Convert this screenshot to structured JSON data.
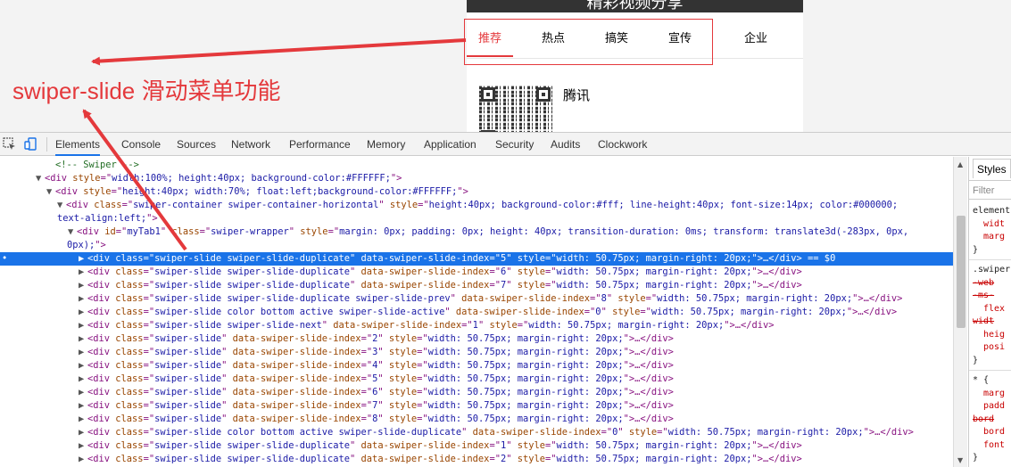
{
  "preview": {
    "header_title": "精彩视频分享",
    "tabs": [
      "推荐",
      "热点",
      "搞笑",
      "宣传",
      "企业"
    ],
    "active_tab_index": 0,
    "news_title": "腾讯"
  },
  "annotation": {
    "text": "swiper-slide 滑动菜单功能",
    "color": "#e4393c"
  },
  "devtools": {
    "tabs": [
      "Elements",
      "Console",
      "Sources",
      "Network",
      "Performance",
      "Memory",
      "Application",
      "Security",
      "Audits",
      "Clockwork"
    ],
    "active_tab": "Elements",
    "lines": [
      {
        "indent": 3,
        "tri": "",
        "html": "<span class='cm'>&lt;!-- Swiper --&gt;</span>"
      },
      {
        "indent": 2,
        "tri": "▼",
        "html": "&lt;div <span class='an'>style</span>=\"<span class='av'>width:100%; height:40px; background-color:#FFFFFF;</span>\"&gt;"
      },
      {
        "indent": 3,
        "tri": "▼",
        "html": "&lt;div <span class='an'>style</span>=\"<span class='av'>height:40px; width:70%; float:left;background-color:#FFFFFF;</span>\"&gt;"
      },
      {
        "indent": 4,
        "tri": "▼",
        "html": "&lt;div <span class='an'>class</span>=\"<span class='av'>swiper-container swiper-container-horizontal</span>\" <span class='an'>style</span>=\"<span class='av'>height:40px; background-color:#fff; line-height:40px; font-size:14px; color:#000000;</span>"
      },
      {
        "indent": 0,
        "tri": "",
        "pad": 54,
        "html": "<span class='av'>text-align:left;</span>\"&gt;"
      },
      {
        "indent": 5,
        "tri": "▼",
        "html": "&lt;div <span class='an'>id</span>=\"<span class='av'>myTab1</span>\" <span class='an'>class</span>=\"<span class='av'>swiper-wrapper</span>\" <span class='an'>style</span>=\"<span class='av'>margin: 0px; padding: 0px; height: 40px; transition-duration: 0ms; transform: translate3d(-283px, 0px,</span>"
      },
      {
        "indent": 0,
        "tri": "",
        "pad": 65,
        "html": "<span class='av'>0px);</span>\"&gt;"
      },
      {
        "indent": 6,
        "tri": "▶",
        "sel": true,
        "html": "&lt;div <span class='an'>class</span>=\"<span class='av'>swiper-slide  swiper-slide-duplicate</span>\" <span class='an'>data-swiper-slide-index</span>=\"<span class='av'>5</span>\" <span class='an'>style</span>=\"<span class='av'>width: 50.75px; margin-right: 20px;</span>\"&gt;…&lt;/div&gt; == $0"
      },
      {
        "indent": 6,
        "tri": "▶",
        "html": "&lt;div <span class='an'>class</span>=\"<span class='av'>swiper-slide  swiper-slide-duplicate</span>\" <span class='an'>data-swiper-slide-index</span>=\"<span class='av'>6</span>\" <span class='an'>style</span>=\"<span class='av'>width: 50.75px; margin-right: 20px;</span>\"&gt;…&lt;/div&gt;"
      },
      {
        "indent": 6,
        "tri": "▶",
        "html": "&lt;div <span class='an'>class</span>=\"<span class='av'>swiper-slide  swiper-slide-duplicate</span>\" <span class='an'>data-swiper-slide-index</span>=\"<span class='av'>7</span>\" <span class='an'>style</span>=\"<span class='av'>width: 50.75px; margin-right: 20px;</span>\"&gt;…&lt;/div&gt;"
      },
      {
        "indent": 6,
        "tri": "▶",
        "html": "&lt;div <span class='an'>class</span>=\"<span class='av'>swiper-slide  swiper-slide-duplicate swiper-slide-prev</span>\" <span class='an'>data-swiper-slide-index</span>=\"<span class='av'>8</span>\" <span class='an'>style</span>=\"<span class='av'>width: 50.75px; margin-right: 20px;</span>\"&gt;…&lt;/div&gt;"
      },
      {
        "indent": 6,
        "tri": "▶",
        "html": "&lt;div <span class='an'>class</span>=\"<span class='av'>swiper-slide color bottom active swiper-slide-active</span>\" <span class='an'>data-swiper-slide-index</span>=\"<span class='av'>0</span>\" <span class='an'>style</span>=\"<span class='av'>width: 50.75px; margin-right: 20px;</span>\"&gt;…&lt;/div&gt;"
      },
      {
        "indent": 6,
        "tri": "▶",
        "html": "&lt;div <span class='an'>class</span>=\"<span class='av'>swiper-slide swiper-slide-next</span>\" <span class='an'>data-swiper-slide-index</span>=\"<span class='av'>1</span>\" <span class='an'>style</span>=\"<span class='av'>width: 50.75px; margin-right: 20px;</span>\"&gt;…&lt;/div&gt;"
      },
      {
        "indent": 6,
        "tri": "▶",
        "html": "&lt;div <span class='an'>class</span>=\"<span class='av'>swiper-slide</span>\" <span class='an'>data-swiper-slide-index</span>=\"<span class='av'>2</span>\" <span class='an'>style</span>=\"<span class='av'>width: 50.75px; margin-right: 20px;</span>\"&gt;…&lt;/div&gt;"
      },
      {
        "indent": 6,
        "tri": "▶",
        "html": "&lt;div <span class='an'>class</span>=\"<span class='av'>swiper-slide</span>\" <span class='an'>data-swiper-slide-index</span>=\"<span class='av'>3</span>\" <span class='an'>style</span>=\"<span class='av'>width: 50.75px; margin-right: 20px;</span>\"&gt;…&lt;/div&gt;"
      },
      {
        "indent": 6,
        "tri": "▶",
        "html": "&lt;div <span class='an'>class</span>=\"<span class='av'>swiper-slide</span>\" <span class='an'>data-swiper-slide-index</span>=\"<span class='av'>4</span>\" <span class='an'>style</span>=\"<span class='av'>width: 50.75px; margin-right: 20px;</span>\"&gt;…&lt;/div&gt;"
      },
      {
        "indent": 6,
        "tri": "▶",
        "html": "&lt;div <span class='an'>class</span>=\"<span class='av'>swiper-slide</span>\" <span class='an'>data-swiper-slide-index</span>=\"<span class='av'>5</span>\" <span class='an'>style</span>=\"<span class='av'>width: 50.75px; margin-right: 20px;</span>\"&gt;…&lt;/div&gt;"
      },
      {
        "indent": 6,
        "tri": "▶",
        "html": "&lt;div <span class='an'>class</span>=\"<span class='av'>swiper-slide</span>\" <span class='an'>data-swiper-slide-index</span>=\"<span class='av'>6</span>\" <span class='an'>style</span>=\"<span class='av'>width: 50.75px; margin-right: 20px;</span>\"&gt;…&lt;/div&gt;"
      },
      {
        "indent": 6,
        "tri": "▶",
        "html": "&lt;div <span class='an'>class</span>=\"<span class='av'>swiper-slide</span>\" <span class='an'>data-swiper-slide-index</span>=\"<span class='av'>7</span>\" <span class='an'>style</span>=\"<span class='av'>width: 50.75px; margin-right: 20px;</span>\"&gt;…&lt;/div&gt;"
      },
      {
        "indent": 6,
        "tri": "▶",
        "html": "&lt;div <span class='an'>class</span>=\"<span class='av'>swiper-slide</span>\" <span class='an'>data-swiper-slide-index</span>=\"<span class='av'>8</span>\" <span class='an'>style</span>=\"<span class='av'>width: 50.75px; margin-right: 20px;</span>\"&gt;…&lt;/div&gt;"
      },
      {
        "indent": 6,
        "tri": "▶",
        "html": "&lt;div <span class='an'>class</span>=\"<span class='av'>swiper-slide color bottom active swiper-slide-duplicate</span>\" <span class='an'>data-swiper-slide-index</span>=\"<span class='av'>0</span>\" <span class='an'>style</span>=\"<span class='av'>width: 50.75px; margin-right: 20px;</span>\"&gt;…&lt;/div&gt;"
      },
      {
        "indent": 6,
        "tri": "▶",
        "html": "&lt;div <span class='an'>class</span>=\"<span class='av'>swiper-slide  swiper-slide-duplicate</span>\" <span class='an'>data-swiper-slide-index</span>=\"<span class='av'>1</span>\" <span class='an'>style</span>=\"<span class='av'>width: 50.75px; margin-right: 20px;</span>\"&gt;…&lt;/div&gt;"
      },
      {
        "indent": 6,
        "tri": "▶",
        "html": "&lt;div <span class='an'>class</span>=\"<span class='av'>swiper-slide  swiper-slide-duplicate</span>\" <span class='an'>data-swiper-slide-index</span>=\"<span class='av'>2</span>\" <span class='an'>style</span>=\"<span class='av'>width: 50.75px; margin-right: 20px;</span>\"&gt;…&lt;/div&gt;"
      }
    ],
    "styles_panel": {
      "tab": "Styles",
      "filter_placeholder": "Filter",
      "rules": [
        {
          "type": "sel",
          "text": "element"
        },
        {
          "type": "prop",
          "text": "widt"
        },
        {
          "type": "prop",
          "text": "marg"
        },
        {
          "type": "brace",
          "text": "}"
        },
        {
          "type": "sep"
        },
        {
          "type": "sel",
          "text": ".swiper"
        },
        {
          "type": "struck",
          "text": "-web"
        },
        {
          "type": "struck",
          "text": "-ms-"
        },
        {
          "type": "prop",
          "text": "flex"
        },
        {
          "type": "struck",
          "text": "widt"
        },
        {
          "type": "prop",
          "text": "heig"
        },
        {
          "type": "prop",
          "text": "posi"
        },
        {
          "type": "brace",
          "text": "}"
        },
        {
          "type": "sep"
        },
        {
          "type": "sel",
          "text": "* {"
        },
        {
          "type": "prop",
          "text": "marg"
        },
        {
          "type": "prop",
          "text": "padd"
        },
        {
          "type": "struck",
          "text": "bord"
        },
        {
          "type": "prop",
          "text": "bord"
        },
        {
          "type": "prop",
          "text": "font"
        },
        {
          "type": "brace",
          "text": "}"
        }
      ]
    }
  }
}
